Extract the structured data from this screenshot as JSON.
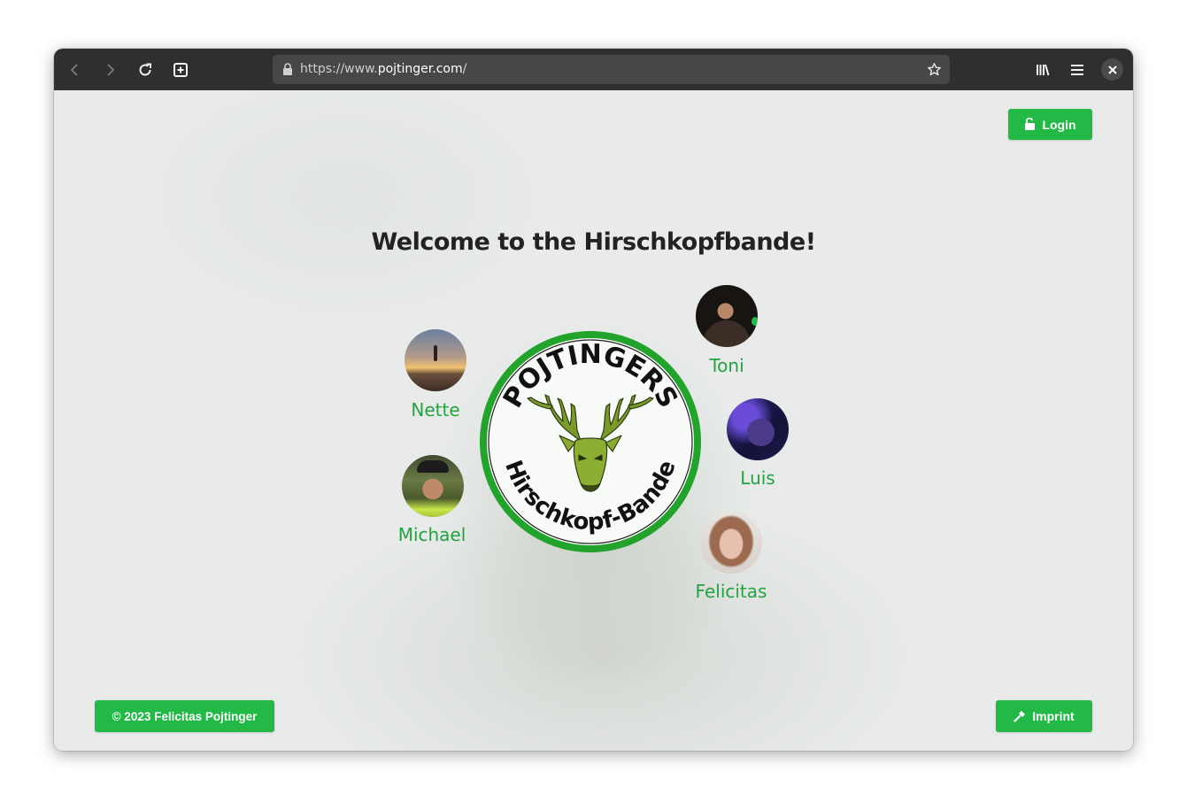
{
  "browser": {
    "url_prefix": "https://www.",
    "url_host": "pojtinger.com",
    "url_suffix": "/"
  },
  "header": {
    "login_label": "Login"
  },
  "main": {
    "title": "Welcome to the Hirschkopfbande!",
    "logo": {
      "top_text": "POJTINGERS",
      "bottom_text": "Hirschkopf-Bande"
    },
    "members": [
      {
        "name": "Nette"
      },
      {
        "name": "Michael"
      },
      {
        "name": "Toni"
      },
      {
        "name": "Luis"
      },
      {
        "name": "Felicitas"
      }
    ]
  },
  "footer": {
    "copyright": "© 2023 Felicitas Pojtinger",
    "imprint_label": "Imprint"
  },
  "colors": {
    "accent": "#22b946",
    "name_text": "#22a340"
  },
  "icons": [
    "back-arrow-icon",
    "forward-arrow-icon",
    "reload-icon",
    "new-tab-icon",
    "lock-icon",
    "star-icon",
    "library-icon",
    "menu-icon",
    "close-icon",
    "unlock-icon",
    "hammer-icon"
  ]
}
